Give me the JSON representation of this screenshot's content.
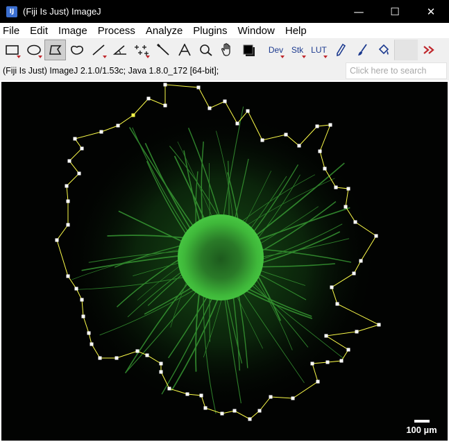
{
  "window": {
    "title": "(Fiji Is Just) ImageJ",
    "icon": "imagej-icon",
    "controls": [
      {
        "name": "minimize",
        "glyph": "—"
      },
      {
        "name": "maximize",
        "glyph": "☐"
      },
      {
        "name": "close",
        "glyph": "✕"
      }
    ]
  },
  "menu": {
    "items": [
      "File",
      "Edit",
      "Image",
      "Process",
      "Analyze",
      "Plugins",
      "Window",
      "Help"
    ]
  },
  "toolbar": {
    "tools": [
      {
        "name": "rectangle-tool",
        "icon": "rectangle-icon",
        "has_menu": true
      },
      {
        "name": "oval-tool",
        "icon": "oval-icon",
        "has_menu": true
      },
      {
        "name": "polygon-tool",
        "icon": "polygon-icon",
        "selected": true
      },
      {
        "name": "freehand-tool",
        "icon": "freehand-icon"
      },
      {
        "name": "line-tool",
        "icon": "line-icon",
        "has_menu": true
      },
      {
        "name": "angle-tool",
        "icon": "angle-icon"
      },
      {
        "name": "point-tool",
        "icon": "multipoint-icon",
        "has_menu": true
      },
      {
        "name": "wand-tool",
        "icon": "wand-icon"
      },
      {
        "name": "text-tool",
        "icon": "text-icon"
      },
      {
        "name": "magnifier-tool",
        "icon": "magnifier-icon"
      },
      {
        "name": "scroll-tool",
        "icon": "hand-icon"
      },
      {
        "name": "color-picker-tool",
        "icon": "color-picker-icon"
      }
    ],
    "menus": {
      "dev": "Dev",
      "stk": "Stk",
      "lut": "LUT"
    },
    "more_icon": "double-chevron-right-icon",
    "accent_color": "#c0282d"
  },
  "status": {
    "text": "(Fiji Is Just) ImageJ 2.1.0/1.53c; Java 1.8.0_172 [64-bit];",
    "search_placeholder": "Click here to search"
  },
  "image": {
    "background": "#020302",
    "cell_color": "#3fc43a",
    "roi_color": "#ffff4a",
    "scale_bar_label": "100 µm"
  }
}
